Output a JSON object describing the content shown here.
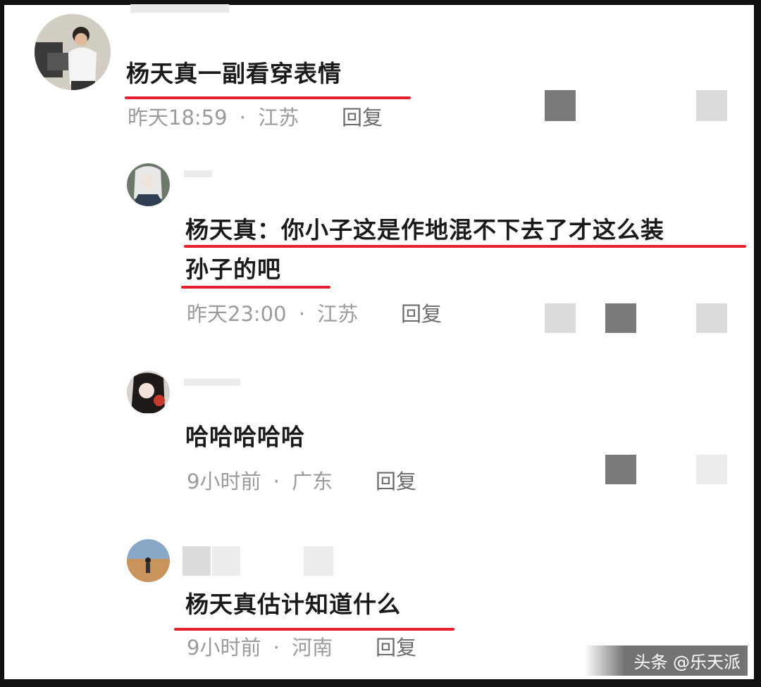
{
  "comments": [
    {
      "text": "杨天真一副看穿表情",
      "time": "昨天18:59",
      "location": "江苏",
      "reply": "回复"
    },
    {
      "text_line1": "杨天真：你小子这是作地混不下去了才这么装",
      "text_line2": "孙子的吧",
      "time": "昨天23:00",
      "location": "江苏",
      "reply": "回复"
    },
    {
      "text": "哈哈哈哈哈",
      "time": "9小时前",
      "location": "广东",
      "reply": "回复"
    },
    {
      "text": "杨天真估计知道什么",
      "time": "9小时前",
      "location": "河南",
      "reply": "回复"
    }
  ],
  "separator": "·",
  "watermark": "头条 @乐天派",
  "colors": {
    "underline": "#e5202c",
    "meta_text": "#9b9b9b",
    "reply_text": "#6b6b6b"
  }
}
